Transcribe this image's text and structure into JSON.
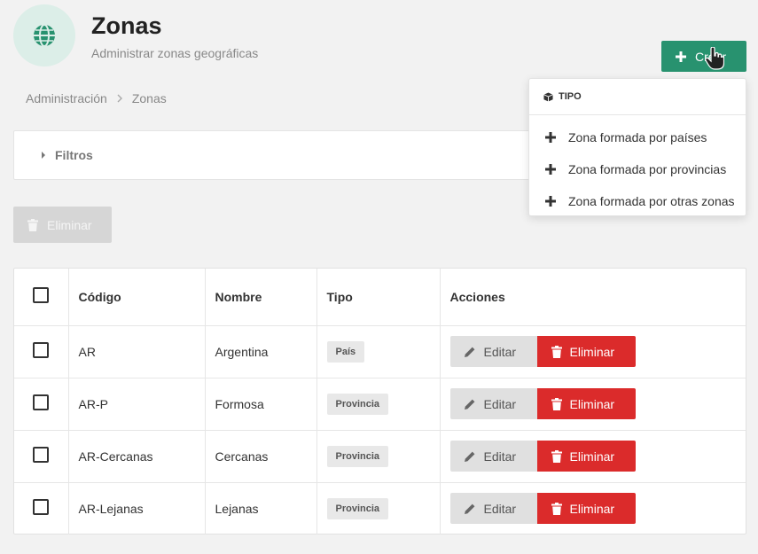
{
  "header": {
    "title": "Zonas",
    "subtitle": "Administrar zonas geográficas",
    "icon": "globe-icon",
    "create_label": "Crear"
  },
  "breadcrumb": {
    "items": [
      "Administración",
      "Zonas"
    ]
  },
  "filters": {
    "label": "Filtros"
  },
  "bulk_delete_label": "Eliminar",
  "dropdown": {
    "header": "TIPO",
    "items": [
      "Zona formada por países",
      "Zona formada por provincias",
      "Zona formada por otras zonas"
    ]
  },
  "table": {
    "columns": [
      "Código",
      "Nombre",
      "Tipo",
      "Acciones"
    ],
    "rows": [
      {
        "code": "AR",
        "name": "Argentina",
        "type": "País"
      },
      {
        "code": "AR-P",
        "name": "Formosa",
        "type": "Provincia"
      },
      {
        "code": "AR-Cercanas",
        "name": "Cercanas",
        "type": "Provincia"
      },
      {
        "code": "AR-Lejanas",
        "name": "Lejanas",
        "type": "Provincia"
      }
    ],
    "edit_label": "Editar",
    "delete_label": "Eliminar"
  },
  "colors": {
    "accent": "#28926f",
    "danger": "#db2b2b",
    "icon_bg": "#dceee8"
  }
}
